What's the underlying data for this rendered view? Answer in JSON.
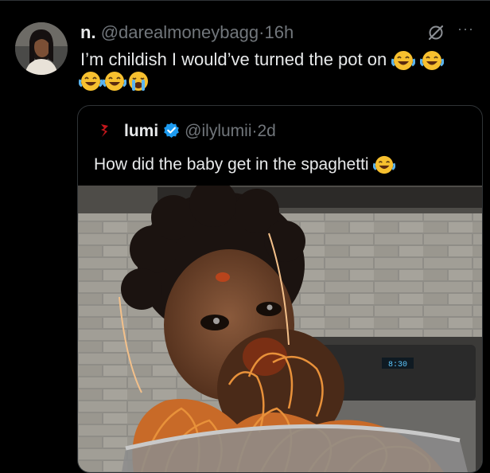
{
  "tweet": {
    "display_name": "n.",
    "handle": "@darealmoneybagg",
    "separator": "·",
    "time": "16h",
    "text": "I’m childish I would’ve turned the pot on",
    "icons": [
      "grok-icon",
      "more-icon",
      "laughing-emoji",
      "crying-emoji"
    ]
  },
  "quote": {
    "display_name": "lumi",
    "handle": "@ilylumii",
    "separator": "·",
    "time": "2d",
    "text": "How did the baby get in the spaghetti"
  },
  "photo": {
    "stove_display": "8:30"
  },
  "colors": {
    "background": "#000000",
    "text": "#e7e9ea",
    "secondary": "#71767b",
    "verified": "#1d9bf0",
    "border": "#2f3336"
  }
}
